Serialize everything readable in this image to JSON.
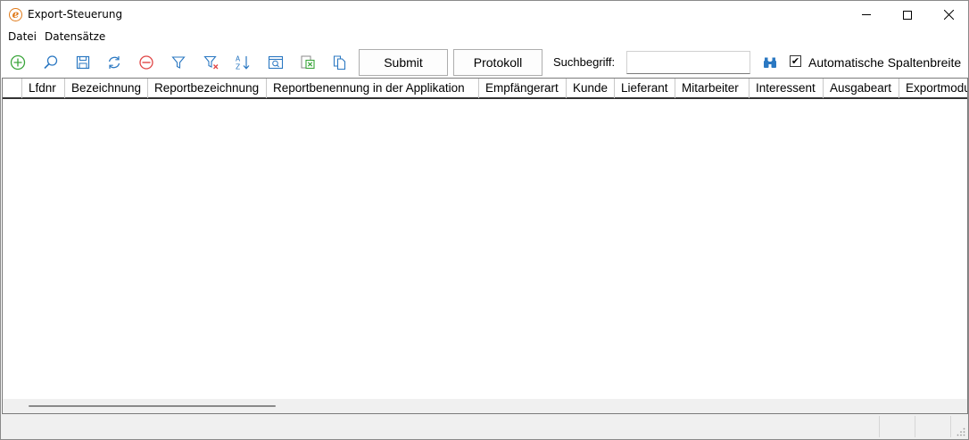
{
  "window": {
    "title": "Export-Steuerung",
    "app_icon_glyph": "e"
  },
  "menu": {
    "items": [
      "Datei",
      "Datensätze"
    ]
  },
  "toolbar": {
    "icons": [
      "add-icon",
      "search-icon",
      "save-icon",
      "refresh-icon",
      "delete-icon",
      "filter-icon",
      "clear-filter-icon",
      "sort-icon",
      "view-icon",
      "excel-export-icon",
      "copy-icon"
    ],
    "submit_label": "Submit",
    "protokoll_label": "Protokoll",
    "search_label": "Suchbegriff:",
    "search_value": "",
    "search_placeholder": "",
    "find_icon": "binoculars-icon",
    "auto_width_checked": true,
    "auto_width_label": "Automatische Spaltenbreite"
  },
  "grid": {
    "columns": [
      "Lfdnr",
      "Bezeichnung",
      "Reportbezeichnung",
      "Reportbenennung in der Applikation",
      "Empfängerart",
      "Kunde",
      "Lieferant",
      "Mitarbeiter",
      "Interessent",
      "Ausgabeart",
      "Exportmodu"
    ],
    "rows": []
  },
  "colors": {
    "accent_green": "#3aa53a",
    "accent_blue": "#2b78c2",
    "accent_red": "#e04545",
    "app_orange": "#e07a1a"
  }
}
